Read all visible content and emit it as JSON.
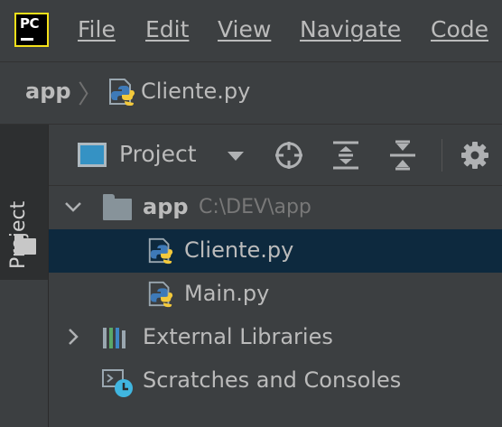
{
  "menubar": {
    "logo_text": "PC",
    "items": [
      "File",
      "Edit",
      "View",
      "Navigate",
      "Code"
    ]
  },
  "breadcrumb": {
    "root": "app",
    "separator": "〉",
    "file": "Cliente.py"
  },
  "toolstrip": {
    "project_tab_label": "Project"
  },
  "panel": {
    "view_selector_label": "Project",
    "icons": [
      "crosshair-icon",
      "expand-all-icon",
      "collapse-all-icon",
      "gear-icon"
    ]
  },
  "tree": {
    "root": {
      "name": "app",
      "path": "C:\\DEV\\app"
    },
    "files": [
      "Cliente.py",
      "Main.py"
    ],
    "external_libraries": "External Libraries",
    "scratches": "Scratches and Consoles"
  },
  "colors": {
    "background": "#2b2b2b",
    "panel": "#3c3f41",
    "selection": "#0d293e",
    "text": "#bbbbbb",
    "path_text": "#787878",
    "logo_border": "#f5e11a"
  }
}
